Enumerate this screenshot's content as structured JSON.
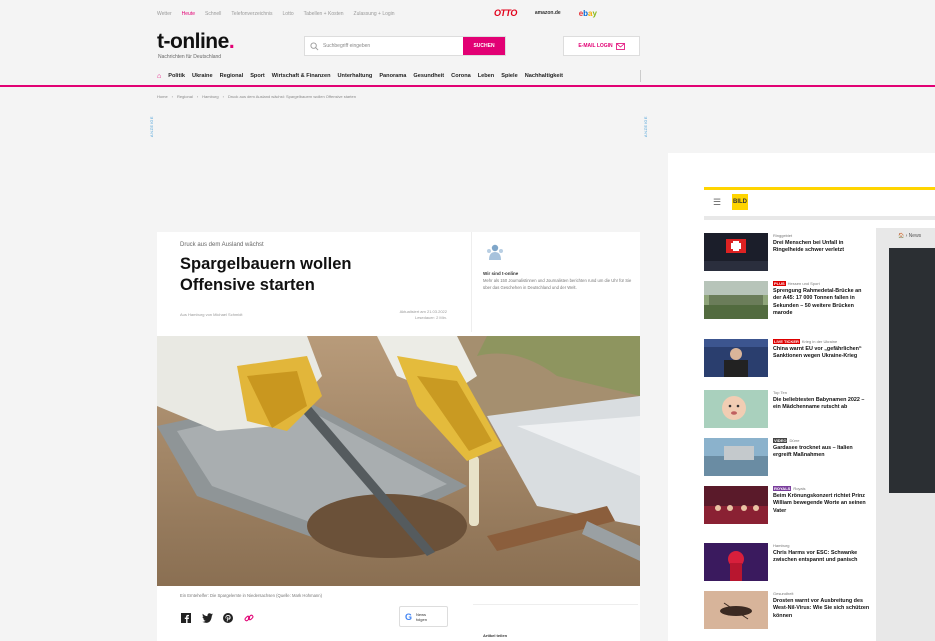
{
  "topbar": {
    "links": [
      "Wetter",
      "Heute",
      "Schnell",
      "Telefonverzeichnis",
      "Lotto",
      "Tabellen + Kosten",
      "Zulassung + Login"
    ],
    "partners": {
      "otto": "OTTO",
      "amazon": "amazon.de",
      "ebay": "ebay"
    }
  },
  "header": {
    "logo": "t-online",
    "slogan": "Nachrichten für Deutschland",
    "search_placeholder": "Suchbegriff eingeben",
    "search_button": "SUCHEN",
    "email_button": "E-MAIL LOGIN"
  },
  "nav": {
    "items": [
      "Politik",
      "Ukraine",
      "Regional",
      "Sport",
      "Wirtschaft & Finanzen",
      "Unterhaltung",
      "Panorama",
      "Gesundheit",
      "Corona",
      "Leben",
      "Spiele",
      "Nachhaltigkeit"
    ]
  },
  "breadcrumb": [
    "Home",
    "Regional",
    "Hamburg",
    "Druck aus dem Ausland wächst: Spargelbauern wollen Offensive starten"
  ],
  "ad_label": "ANZEIGE",
  "article": {
    "kicker": "Druck aus dem Ausland wächst",
    "headline": "Spargelbauern wollen Offensive starten",
    "author": "Aus Hamburg von Michael Schmidt",
    "date_line1": "Aktualisiert am 21.03.2022",
    "date_line2": "Lesedauer: 2 Min.",
    "aside_title": "Wir sind t-online",
    "aside_text": "Mehr als 150 Journalistinnen und Journalisten berichten rund um die Uhr für Sie über das Geschehen in Deutschland und der Welt.",
    "caption": "Ein Erntehelfer: Die Spargelernte in Niedersachsen (Quelle: Mark Hohmann)",
    "gnews_label1": "News",
    "gnews_label2": "folgen",
    "right_label": "Artikel teilen"
  },
  "panel": {
    "brand": "BILD",
    "breadcrumb": "› News",
    "news": [
      {
        "kicker": "Ringgebiet",
        "badge": "",
        "title": "Drei Menschen bei Unfall in Ringelheide schwer verletzt"
      },
      {
        "kicker": "Hessen und Sport",
        "badge": "PLUS",
        "title": "Sprengung Rahmedetal-Brücke an der A45: 17 000 Tonnen fallen in Sekunden – 50 weitere Brücken marode"
      },
      {
        "kicker": "Krieg in der Ukraine",
        "badge": "LIVE TICKER",
        "title": "China warnt EU vor „gefährlichen“ Sanktionen wegen Ukraine-Krieg"
      },
      {
        "kicker": "Top Ten",
        "badge": "",
        "title": "Die beliebtesten Babynamen 2022 – ein Mädchenname rutscht ab"
      },
      {
        "kicker": "Dürre",
        "badge": "VIDEO",
        "title": "Gardasee trocknet aus – Italien ergreift Maßnahmen"
      },
      {
        "kicker": "Royals",
        "badge": "ROYALS",
        "title": "Beim Krönungskonzert richtet Prinz William bewegende Worte an seinen Vater"
      },
      {
        "kicker": "Hamburg",
        "badge": "",
        "title": "Chris Harms vor ESC: Schwanke zwischen entspannt und panisch"
      },
      {
        "kicker": "Gesundheit",
        "badge": "",
        "title": "Drosten warnt vor Ausbreitung des West-Nil-Virus: Wie Sie sich schützen können"
      }
    ]
  }
}
